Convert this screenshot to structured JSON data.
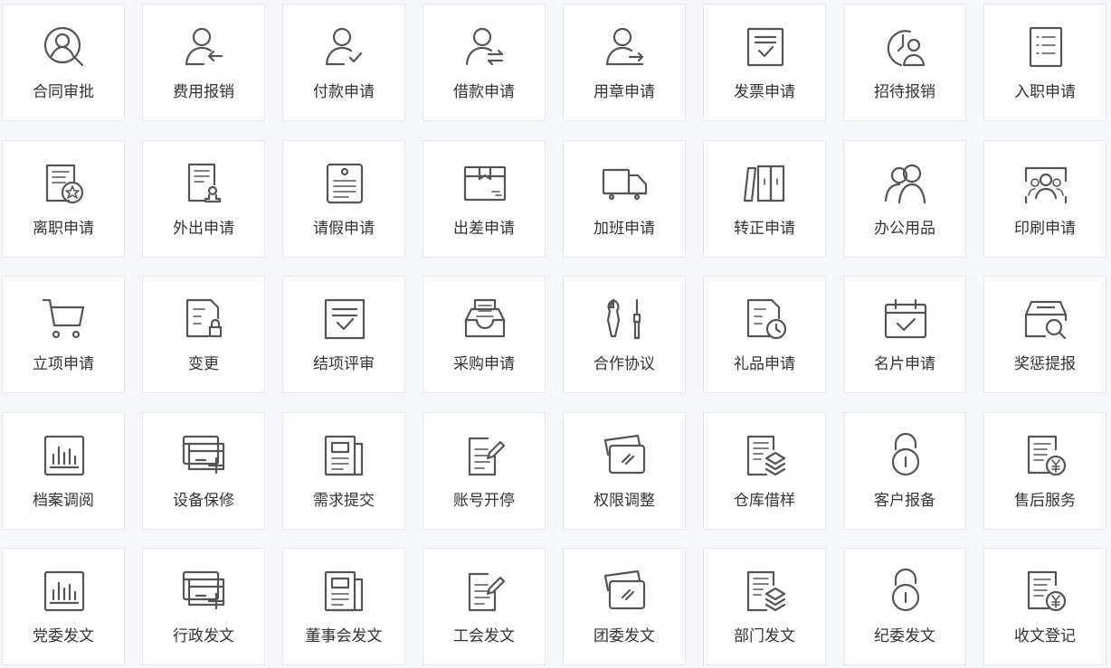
{
  "tiles": [
    {
      "label": "合同审批",
      "icon": "contract-approval-icon"
    },
    {
      "label": "费用报销",
      "icon": "expense-reimbursement-icon"
    },
    {
      "label": "付款申请",
      "icon": "payment-request-icon"
    },
    {
      "label": "借款申请",
      "icon": "loan-request-icon"
    },
    {
      "label": "用章申请",
      "icon": "seal-use-request-icon"
    },
    {
      "label": "发票申请",
      "icon": "invoice-request-icon"
    },
    {
      "label": "招待报销",
      "icon": "hospitality-reimbursement-icon"
    },
    {
      "label": "入职申请",
      "icon": "onboarding-request-icon"
    },
    {
      "label": "离职申请",
      "icon": "resignation-request-icon"
    },
    {
      "label": "外出申请",
      "icon": "outing-request-icon"
    },
    {
      "label": "请假申请",
      "icon": "leave-request-icon"
    },
    {
      "label": "出差申请",
      "icon": "business-trip-request-icon"
    },
    {
      "label": "加班申请",
      "icon": "overtime-request-icon"
    },
    {
      "label": "转正申请",
      "icon": "regularization-request-icon"
    },
    {
      "label": "办公用品",
      "icon": "office-supplies-icon"
    },
    {
      "label": "印刷申请",
      "icon": "printing-request-icon"
    },
    {
      "label": "立项申请",
      "icon": "project-initiation-icon"
    },
    {
      "label": "变更",
      "icon": "change-icon"
    },
    {
      "label": "结项评审",
      "icon": "project-closure-review-icon"
    },
    {
      "label": "采购申请",
      "icon": "purchase-request-icon"
    },
    {
      "label": "合作协议",
      "icon": "cooperation-agreement-icon"
    },
    {
      "label": "礼品申请",
      "icon": "gift-request-icon"
    },
    {
      "label": "名片申请",
      "icon": "business-card-request-icon"
    },
    {
      "label": "奖惩提报",
      "icon": "reward-punishment-icon"
    },
    {
      "label": "档案调阅",
      "icon": "archive-access-icon"
    },
    {
      "label": "设备保修",
      "icon": "equipment-repair-icon"
    },
    {
      "label": "需求提交",
      "icon": "requirement-submit-icon"
    },
    {
      "label": "账号开停",
      "icon": "account-toggle-icon"
    },
    {
      "label": "权限调整",
      "icon": "permission-adjust-icon"
    },
    {
      "label": "仓库借样",
      "icon": "warehouse-sample-icon"
    },
    {
      "label": "客户报备",
      "icon": "customer-report-icon"
    },
    {
      "label": "售后服务",
      "icon": "after-sales-icon"
    },
    {
      "label": "党委发文",
      "icon": "party-committee-doc-icon"
    },
    {
      "label": "行政发文",
      "icon": "administrative-doc-icon"
    },
    {
      "label": "董事会发文",
      "icon": "board-doc-icon"
    },
    {
      "label": "工会发文",
      "icon": "union-doc-icon"
    },
    {
      "label": "团委发文",
      "icon": "youth-league-doc-icon"
    },
    {
      "label": "部门发文",
      "icon": "department-doc-icon"
    },
    {
      "label": "纪委发文",
      "icon": "discipline-committee-doc-icon"
    },
    {
      "label": "收文登记",
      "icon": "incoming-doc-registration-icon"
    }
  ],
  "colors": {
    "background": "#f6f7fb",
    "tile": "#ffffff",
    "tile_border": "#e6e8ee",
    "icon": "#555555",
    "text": "#333333"
  }
}
